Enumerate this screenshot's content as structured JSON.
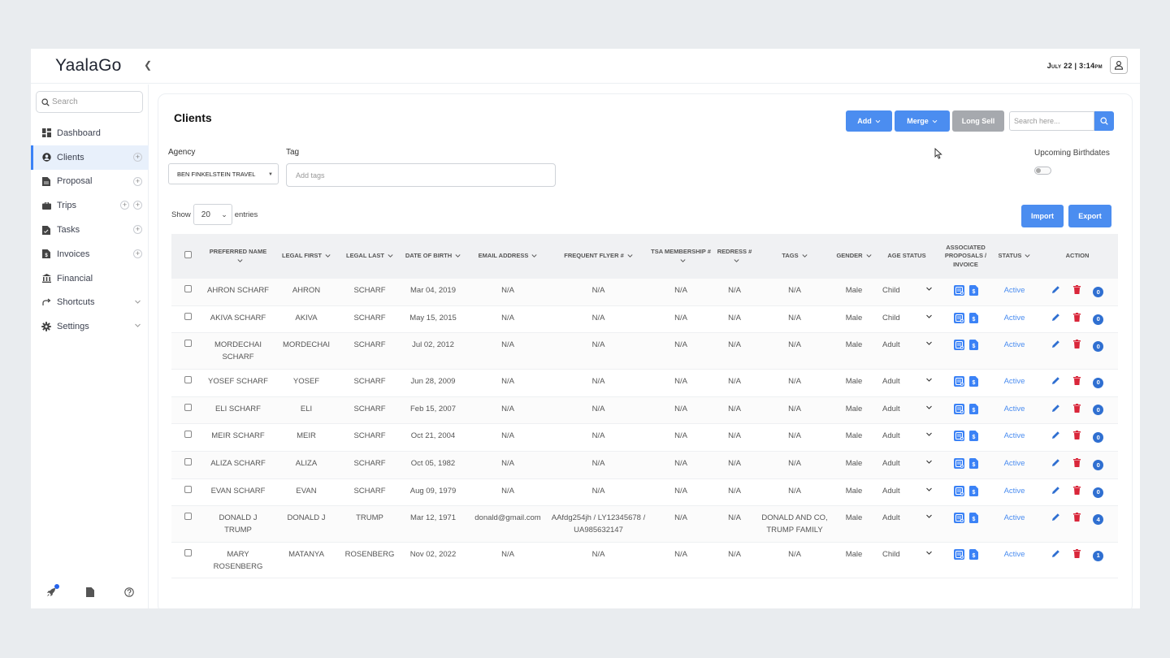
{
  "app": {
    "name": "YaalaGo",
    "datetime": "July 22 | 3:14pm"
  },
  "sidebar": {
    "search_placeholder": "Search",
    "items": [
      {
        "label": "Dashboard",
        "icon": "dashboard-icon"
      },
      {
        "label": "Clients",
        "icon": "clients-icon"
      },
      {
        "label": "Proposal",
        "icon": "proposal-icon"
      },
      {
        "label": "Trips",
        "icon": "trips-icon"
      },
      {
        "label": "Tasks",
        "icon": "tasks-icon"
      },
      {
        "label": "Invoices",
        "icon": "invoices-icon"
      },
      {
        "label": "Financial",
        "icon": "financial-icon"
      },
      {
        "label": "Shortcuts",
        "icon": "shortcut-arrow-icon"
      },
      {
        "label": "Settings",
        "icon": "gear-icon"
      }
    ],
    "active": "Clients"
  },
  "page": {
    "title": "Clients",
    "buttons": {
      "add": "Add",
      "merge": "Merge",
      "long_sell": "Long Sell",
      "import": "Import",
      "export": "Export"
    },
    "search_placeholder": "Search here...",
    "agency_label": "Agency",
    "agency_value": "BEN FINKELSTEIN TRAVEL",
    "tag_label": "Tag",
    "tag_placeholder": "Add tags",
    "birthdates_label": "Upcoming Birthdates",
    "show_label": "Show",
    "entries_value": "20",
    "entries_label": "entries"
  },
  "table": {
    "columns": [
      "Preferred Name",
      "Legal First",
      "Legal Last",
      "Date of Birth",
      "Email Address",
      "Frequent Flyer #",
      "TSA Membership #",
      "Redress #",
      "Tags",
      "Gender",
      "Age Status",
      "Associated Proposals / Invoice",
      "Status",
      "Action"
    ],
    "rows": [
      {
        "preferred": "AHRON SCHARF",
        "first": "AHRON",
        "last": "SCHARF",
        "dob": "Mar 04, 2019",
        "email": "N/A",
        "ff": "N/A",
        "tsa": "N/A",
        "redress": "N/A",
        "tags": "N/A",
        "gender": "Male",
        "age": "Child",
        "status": "Active",
        "count": "0"
      },
      {
        "preferred": "AKIVA SCHARF",
        "first": "AKIVA",
        "last": "SCHARF",
        "dob": "May 15, 2015",
        "email": "N/A",
        "ff": "N/A",
        "tsa": "N/A",
        "redress": "N/A",
        "tags": "N/A",
        "gender": "Male",
        "age": "Child",
        "status": "Active",
        "count": "0"
      },
      {
        "preferred": "MORDECHAI SCHARF",
        "first": "MORDECHAI",
        "last": "SCHARF",
        "dob": "Jul 02, 2012",
        "email": "N/A",
        "ff": "N/A",
        "tsa": "N/A",
        "redress": "N/A",
        "tags": "N/A",
        "gender": "Male",
        "age": "Adult",
        "status": "Active",
        "count": "0"
      },
      {
        "preferred": "YOSEF SCHARF",
        "first": "YOSEF",
        "last": "SCHARF",
        "dob": "Jun 28, 2009",
        "email": "N/A",
        "ff": "N/A",
        "tsa": "N/A",
        "redress": "N/A",
        "tags": "N/A",
        "gender": "Male",
        "age": "Adult",
        "status": "Active",
        "count": "0"
      },
      {
        "preferred": "ELI SCHARF",
        "first": "ELI",
        "last": "SCHARF",
        "dob": "Feb 15, 2007",
        "email": "N/A",
        "ff": "N/A",
        "tsa": "N/A",
        "redress": "N/A",
        "tags": "N/A",
        "gender": "Male",
        "age": "Adult",
        "status": "Active",
        "count": "0"
      },
      {
        "preferred": "MEIR SCHARF",
        "first": "MEIR",
        "last": "SCHARF",
        "dob": "Oct 21, 2004",
        "email": "N/A",
        "ff": "N/A",
        "tsa": "N/A",
        "redress": "N/A",
        "tags": "N/A",
        "gender": "Male",
        "age": "Adult",
        "status": "Active",
        "count": "0"
      },
      {
        "preferred": "ALIZA SCHARF",
        "first": "ALIZA",
        "last": "SCHARF",
        "dob": "Oct 05, 1982",
        "email": "N/A",
        "ff": "N/A",
        "tsa": "N/A",
        "redress": "N/A",
        "tags": "N/A",
        "gender": "Male",
        "age": "Adult",
        "status": "Active",
        "count": "0"
      },
      {
        "preferred": "EVAN SCHARF",
        "first": "EVAN",
        "last": "SCHARF",
        "dob": "Aug 09, 1979",
        "email": "N/A",
        "ff": "N/A",
        "tsa": "N/A",
        "redress": "N/A",
        "tags": "N/A",
        "gender": "Male",
        "age": "Adult",
        "status": "Active",
        "count": "0"
      },
      {
        "preferred": "DONALD J TRUMP",
        "first": "DONALD J",
        "last": "TRUMP",
        "dob": "Mar 12, 1971",
        "email": "donald@gmail.com",
        "ff": "AAfdg254jh / LY12345678 / UA985632147",
        "tsa": "N/A",
        "redress": "N/A",
        "tags": "DONALD AND CO, TRUMP FAMILY",
        "gender": "Male",
        "age": "Adult",
        "status": "Active",
        "count": "4"
      },
      {
        "preferred": "MARY ROSENBERG",
        "first": "MATANYA",
        "last": "ROSENBERG",
        "dob": "Nov 02, 2022",
        "email": "N/A",
        "ff": "N/A",
        "tsa": "N/A",
        "redress": "N/A",
        "tags": "N/A",
        "gender": "Male",
        "age": "Child",
        "status": "Active",
        "count": "1"
      }
    ]
  },
  "colors": {
    "accent": "#4b8df0",
    "delete": "#d9263a",
    "badge": "#2f6fd1",
    "disabled": "#a6a9ae"
  }
}
